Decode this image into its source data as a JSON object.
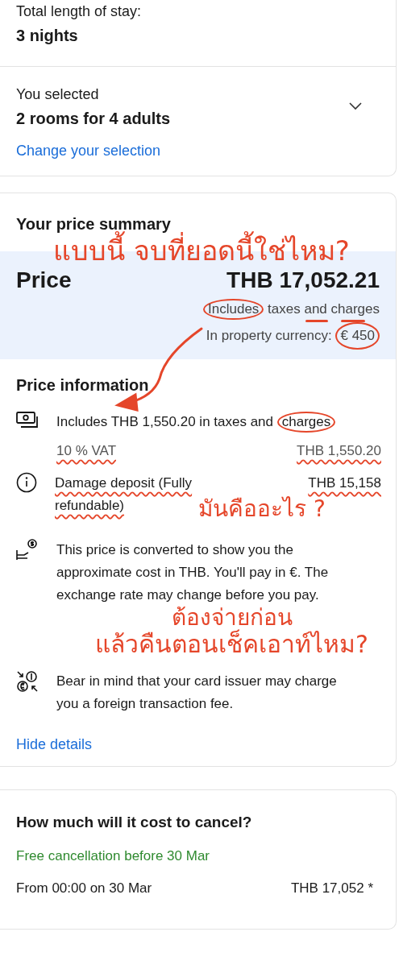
{
  "stay": {
    "label": "Total length of stay:",
    "value": "3 nights"
  },
  "selection": {
    "label": "You selected",
    "value": "2 rooms for 4 adults",
    "expanded": false,
    "link": "Change your selection"
  },
  "price_summary": {
    "title": "Your price summary",
    "price_label": "Price",
    "price": "THB 17,052.21",
    "note": "Includes taxes and charges",
    "property_currency": "In property currency: € 450"
  },
  "price_information": {
    "title": "Price information",
    "rows": [
      {
        "kind": "charges",
        "text": "Includes THB 1,550.20 in taxes and charges",
        "sub_label": "10 % VAT",
        "sub_amount": "THB 1,550.20"
      },
      {
        "kind": "deposit",
        "text": "Damage deposit (Fully refundable)",
        "amount": "THB 15,158"
      },
      {
        "kind": "converted",
        "text": "This price is converted to show you the approximate cost in THB. You'll pay in €. The exchange rate may change before you pay."
      },
      {
        "kind": "fee",
        "text": "Bear in mind that your card issuer may charge you a foreign transaction fee."
      }
    ],
    "link": "Hide details"
  },
  "cancellation": {
    "title": "How much will it cost to cancel?",
    "free_until": "Free cancellation before 30 Mar",
    "from": "From 00:00 on 30 Mar",
    "amount": "THB 17,052 *"
  },
  "annotations": [
    "แบบนี้ จบที่ยอดนี้ใช่ไหม?",
    "มันคืออะไร ?",
    "ต้องจ่ายก่อน",
    "แล้วคืนตอนเช็คเอาท์ไหม?"
  ]
}
